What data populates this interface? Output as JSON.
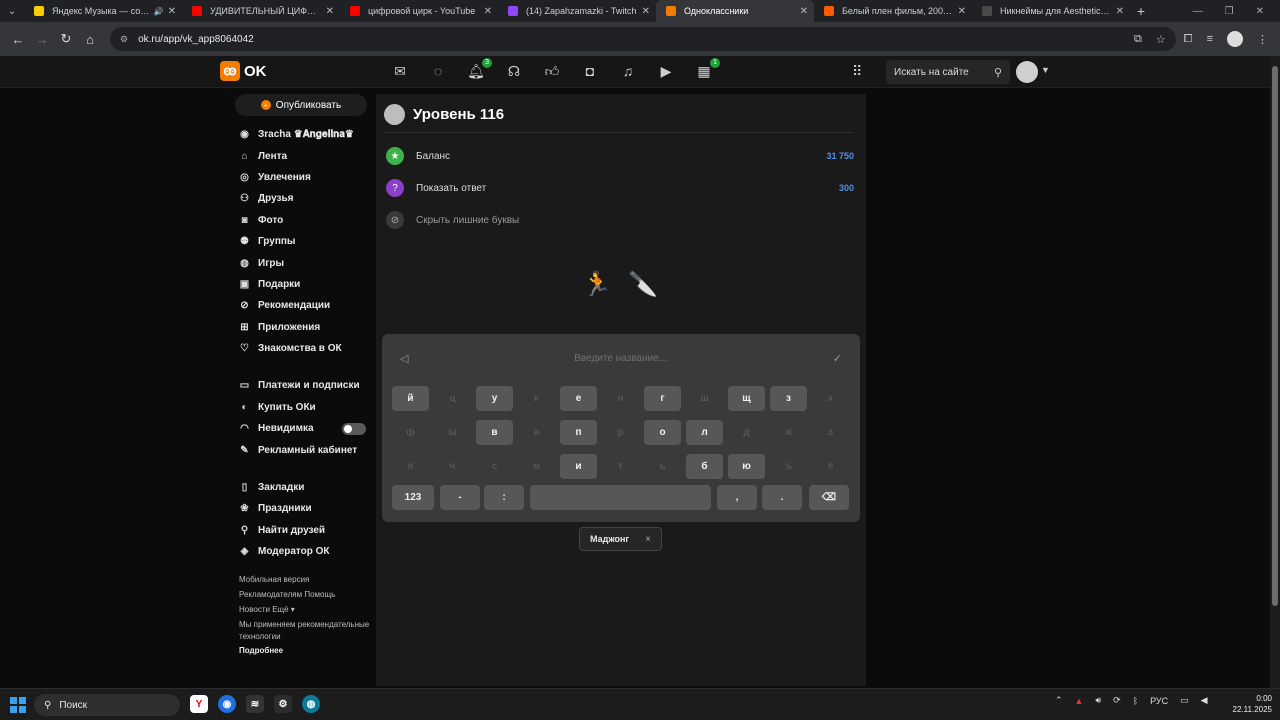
{
  "browser": {
    "tabs": [
      {
        "title": "Яндекс Музыка — собирайте",
        "fav_color": "#ffcc00",
        "sound": "🔊"
      },
      {
        "title": "УДИВИТЕЛЬНЫЙ ЦИФРОВОЙ",
        "fav_color": "#ff0000",
        "sound": ""
      },
      {
        "title": "цифровой цирк - YouTube",
        "fav_color": "#ff0000",
        "sound": ""
      },
      {
        "title": "(14) Zapahzamazki - Twitch",
        "fav_color": "#9146ff",
        "sound": ""
      },
      {
        "title": "Одноклассники",
        "fav_color": "#f27d00",
        "sound": ""
      },
      {
        "title": "Белый плен фильм, 2005, дата",
        "fav_color": "#ff5a00",
        "sound": ""
      },
      {
        "title": "Никнеймы для Aesthetic 💡 и",
        "fav_color": "#4a4a4a",
        "sound": ""
      }
    ],
    "active_tab_index": 4,
    "url": "ok.ru/app/vk_app8064042"
  },
  "ok_header": {
    "logo_text": "OK",
    "badges": {
      "notifications": "3",
      "events": "1"
    },
    "search_placeholder": "Искать на сайте"
  },
  "sidebar": {
    "publish_label": "Опубликовать",
    "items": [
      {
        "icon": "user-icon",
        "glyph": "◉",
        "label": "Зracha ♛𝐀𝐧𝐠𝐞𝐥𝐥𝐧𝐚♛"
      },
      {
        "icon": "home-icon",
        "glyph": "⌂",
        "label": "Лента"
      },
      {
        "icon": "hobby-icon",
        "glyph": "◎",
        "label": "Увлечения"
      },
      {
        "icon": "friends-icon",
        "glyph": "⚇",
        "label": "Друзья"
      },
      {
        "icon": "camera-icon",
        "glyph": "◙",
        "label": "Фото"
      },
      {
        "icon": "groups-icon",
        "glyph": "⚉",
        "label": "Группы"
      },
      {
        "icon": "gamepad-icon",
        "glyph": "◍",
        "label": "Игры"
      },
      {
        "icon": "gift-icon",
        "glyph": "▣",
        "label": "Подарки"
      },
      {
        "icon": "compass-icon",
        "glyph": "⊘",
        "label": "Рекомендации"
      },
      {
        "icon": "apps-icon",
        "glyph": "⊞",
        "label": "Приложения"
      },
      {
        "icon": "dating-icon",
        "glyph": "♡",
        "label": "Знакомства в ОК"
      }
    ],
    "items2": [
      {
        "icon": "wallet-icon",
        "glyph": "▭",
        "label": "Платежи и подписки"
      },
      {
        "icon": "oki-icon",
        "glyph": "◐",
        "label": "Купить ОКи"
      },
      {
        "icon": "invisible-icon",
        "glyph": "◠",
        "label": "Невидимка"
      },
      {
        "icon": "ads-icon",
        "glyph": "✎",
        "label": "Рекламный кабинет"
      }
    ],
    "items3": [
      {
        "icon": "bookmark-icon",
        "glyph": "▯",
        "label": "Закладки"
      },
      {
        "icon": "holiday-icon",
        "glyph": "❀",
        "label": "Праздники"
      },
      {
        "icon": "find-friends-icon",
        "glyph": "⚲",
        "label": "Найти друзей"
      },
      {
        "icon": "moderator-icon",
        "glyph": "◈",
        "label": "Модератор ОК"
      }
    ],
    "footer": {
      "mobile": "Мобильная версия",
      "advertisers": "Рекламодателям",
      "help": "Помощь",
      "news": "Новости",
      "more": "Ещё ▾",
      "tech": "Мы применяем рекомендательные технологии",
      "details": "Подробнее"
    }
  },
  "game": {
    "level_title": "Уровень 116",
    "balance_label": "Баланс",
    "balance_value": "31 750",
    "hint_label": "Показать ответ",
    "hint_cost": "300",
    "hide_label": "Скрыть лишние буквы",
    "emoji_1": "🏃",
    "emoji_2": "🔪",
    "input_placeholder": "Введите название...",
    "keyboard_rows": [
      [
        {
          "k": "й",
          "on": true
        },
        {
          "k": "ц",
          "on": false
        },
        {
          "k": "у",
          "on": true
        },
        {
          "k": "к",
          "on": false
        },
        {
          "k": "е",
          "on": true
        },
        {
          "k": "н",
          "on": false
        },
        {
          "k": "г",
          "on": true
        },
        {
          "k": "ш",
          "on": false
        },
        {
          "k": "щ",
          "on": true
        },
        {
          "k": "з",
          "on": true
        },
        {
          "k": "х",
          "on": false
        }
      ],
      [
        {
          "k": "ф",
          "on": false
        },
        {
          "k": "ы",
          "on": false
        },
        {
          "k": "в",
          "on": true
        },
        {
          "k": "а",
          "on": false
        },
        {
          "k": "п",
          "on": true
        },
        {
          "k": "р",
          "on": false
        },
        {
          "k": "о",
          "on": true
        },
        {
          "k": "л",
          "on": true
        },
        {
          "k": "д",
          "on": false
        },
        {
          "k": "ж",
          "on": false
        },
        {
          "k": "э",
          "on": false
        }
      ],
      [
        {
          "k": "я",
          "on": false
        },
        {
          "k": "ч",
          "on": false
        },
        {
          "k": "с",
          "on": false
        },
        {
          "k": "м",
          "on": false
        },
        {
          "k": "и",
          "on": true
        },
        {
          "k": "т",
          "on": false
        },
        {
          "k": "ь",
          "on": false
        },
        {
          "k": "б",
          "on": true
        },
        {
          "k": "ю",
          "on": true
        },
        {
          "k": "ъ",
          "on": false
        },
        {
          "k": "ё",
          "on": false
        }
      ]
    ],
    "bottom_row": {
      "num": "123",
      "dash": "-",
      "colon": ":",
      "comma": ",",
      "dot": ".",
      "backspace": "⌫"
    },
    "chip_label": "Маджонг"
  },
  "taskbar": {
    "search_label": "Поиск",
    "lang": "РУС",
    "time": "0:00",
    "date": "22.11.2025"
  }
}
